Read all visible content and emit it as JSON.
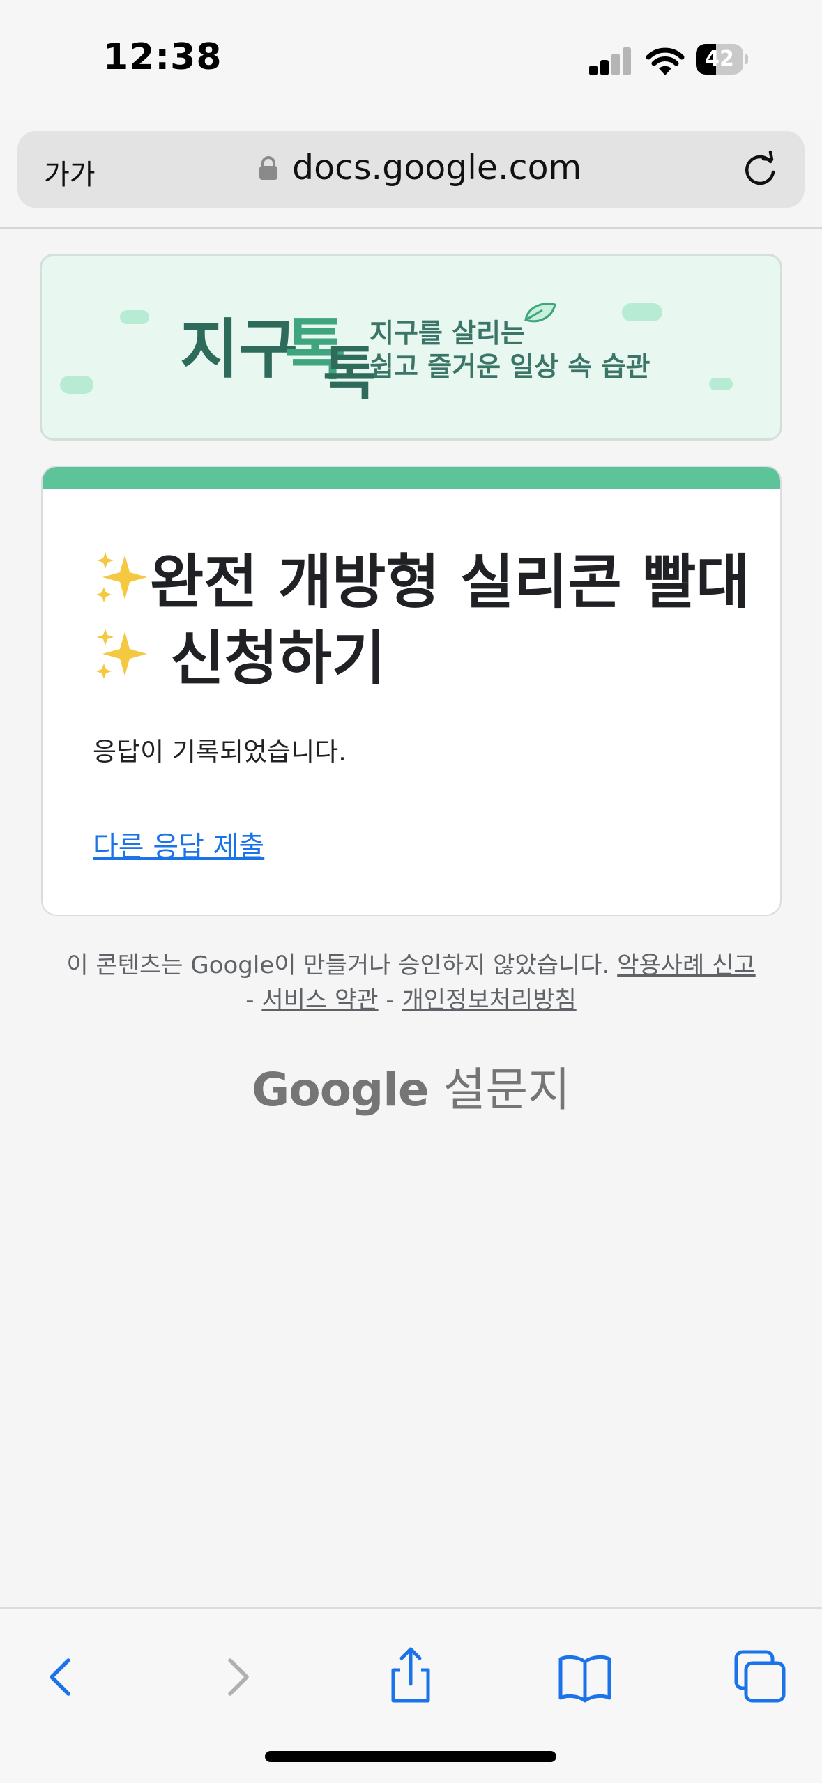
{
  "status_bar": {
    "time": "12:38",
    "battery_level": "42",
    "icons": [
      "cellular-signal-icon",
      "wifi-icon",
      "battery-icon"
    ]
  },
  "browser": {
    "text_size_label": "가가",
    "url": "docs.google.com",
    "icons": [
      "lock-icon",
      "reload-icon"
    ]
  },
  "banner": {
    "logo_text": "지구톡톡",
    "tagline_line1": "지구를 살리는",
    "tagline_line2": "쉽고 즐거운 일상 속 습관",
    "icons": [
      "leaf-icon",
      "cloud-icon"
    ]
  },
  "form": {
    "title_line1": "완전 개방형 실리콘 빨대",
    "title_line2": "신청하기",
    "title_emoji": "✨",
    "confirmation_message": "응답이 기록되었습니다.",
    "another_response_link": "다른 응답 제출",
    "accent_color": "#5dc49a"
  },
  "footer": {
    "disclaimer": "이 콘텐츠는 Google이 만들거나 승인하지 않았습니다.",
    "report_abuse": "악용사례 신고",
    "separator": "-",
    "terms": "서비스 약관",
    "privacy": "개인정보처리방침",
    "brand_google": "Google",
    "brand_forms": "설문지"
  },
  "toolbar": {
    "buttons": [
      "back-icon",
      "forward-icon",
      "share-icon",
      "bookmarks-icon",
      "tabs-icon"
    ],
    "link_color": "#1a73e8"
  }
}
